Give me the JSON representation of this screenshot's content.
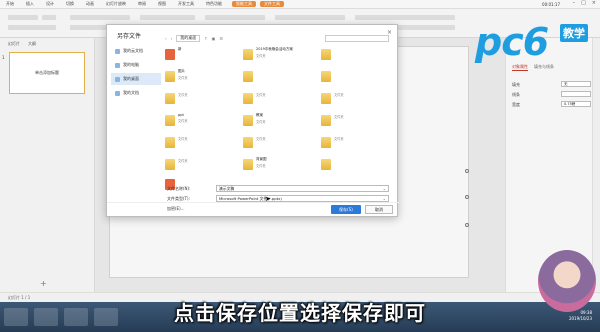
{
  "titlebar": {
    "tabs": [
      "开始",
      "插入",
      "设计",
      "切换",
      "动画",
      "幻灯片放映",
      "审阅",
      "视图",
      "开发工具",
      "特色功能"
    ],
    "highlight_tabs": [
      "智能工具",
      "文件工具"
    ],
    "time": "00:01:17"
  },
  "left_panel": {
    "tabs": [
      "幻灯片",
      "大纲"
    ],
    "slide_number": "1",
    "thumb_title": "单击添加标题"
  },
  "dialog": {
    "title": "另存文件",
    "close": "×",
    "nav": [
      "我的云文档",
      "我的电脑",
      "我的桌面",
      "我的文档"
    ],
    "address": {
      "location": "我的桌面"
    },
    "files": [
      {
        "name": "新",
        "sub": "",
        "kind": "pptx"
      },
      {
        "name": "2019中秋晚会活动方案",
        "sub": "文件夹",
        "kind": "folder"
      },
      {
        "name": "",
        "sub": "",
        "kind": "folder"
      },
      {
        "name": "图片",
        "sub": "文件夹",
        "kind": "folder"
      },
      {
        "name": "",
        "sub": "",
        "kind": "folder"
      },
      {
        "name": "",
        "sub": "",
        "kind": "folder"
      },
      {
        "name": "",
        "sub": "文件夹",
        "kind": "folder"
      },
      {
        "name": "",
        "sub": "文件夹",
        "kind": "folder"
      },
      {
        "name": "",
        "sub": "文件夹",
        "kind": "folder"
      },
      {
        "name": "ppt",
        "sub": "文件夹",
        "kind": "folder"
      },
      {
        "name": "教案",
        "sub": "文件夹",
        "kind": "folder"
      },
      {
        "name": "",
        "sub": "文件夹",
        "kind": "folder"
      },
      {
        "name": "",
        "sub": "文件夹",
        "kind": "folder"
      },
      {
        "name": "",
        "sub": "文件夹",
        "kind": "folder"
      },
      {
        "name": "",
        "sub": "文件夹",
        "kind": "folder"
      },
      {
        "name": "",
        "sub": "文件夹",
        "kind": "folder"
      },
      {
        "name": "背景图",
        "sub": "文件夹",
        "kind": "folder"
      },
      {
        "name": "",
        "sub": "",
        "kind": "folder"
      },
      {
        "name": "",
        "sub": "",
        "kind": "pptx"
      }
    ],
    "filename_label": "文件名称(N):",
    "filename_value": "演示文稿",
    "filetype_label": "文件类型(T):",
    "filetype_value": "Microsoft PowerPoint 文件(*.pptx)",
    "encrypt_label": "加密(E)...",
    "save_label": "保存(S)",
    "cancel_label": "取消"
  },
  "right_panel": {
    "tabs": [
      "对象属性",
      "填充与线条"
    ],
    "rows": [
      {
        "label": "填充",
        "value": "无"
      },
      {
        "label": "线条",
        "value": ""
      },
      {
        "label": "宽度",
        "value": "0.75磅"
      }
    ]
  },
  "logo": {
    "text": "pc6",
    "badge": "教学"
  },
  "statusbar": {
    "text": "幻灯片 1 / 1"
  },
  "subtitle": "点击保存位置选择保存即可",
  "tray": {
    "time": "09:38",
    "date": "2019/10/23"
  },
  "colors": {
    "accent": "#2b79d8",
    "logo": "#1e9ee0",
    "folder": "#e6b538"
  }
}
